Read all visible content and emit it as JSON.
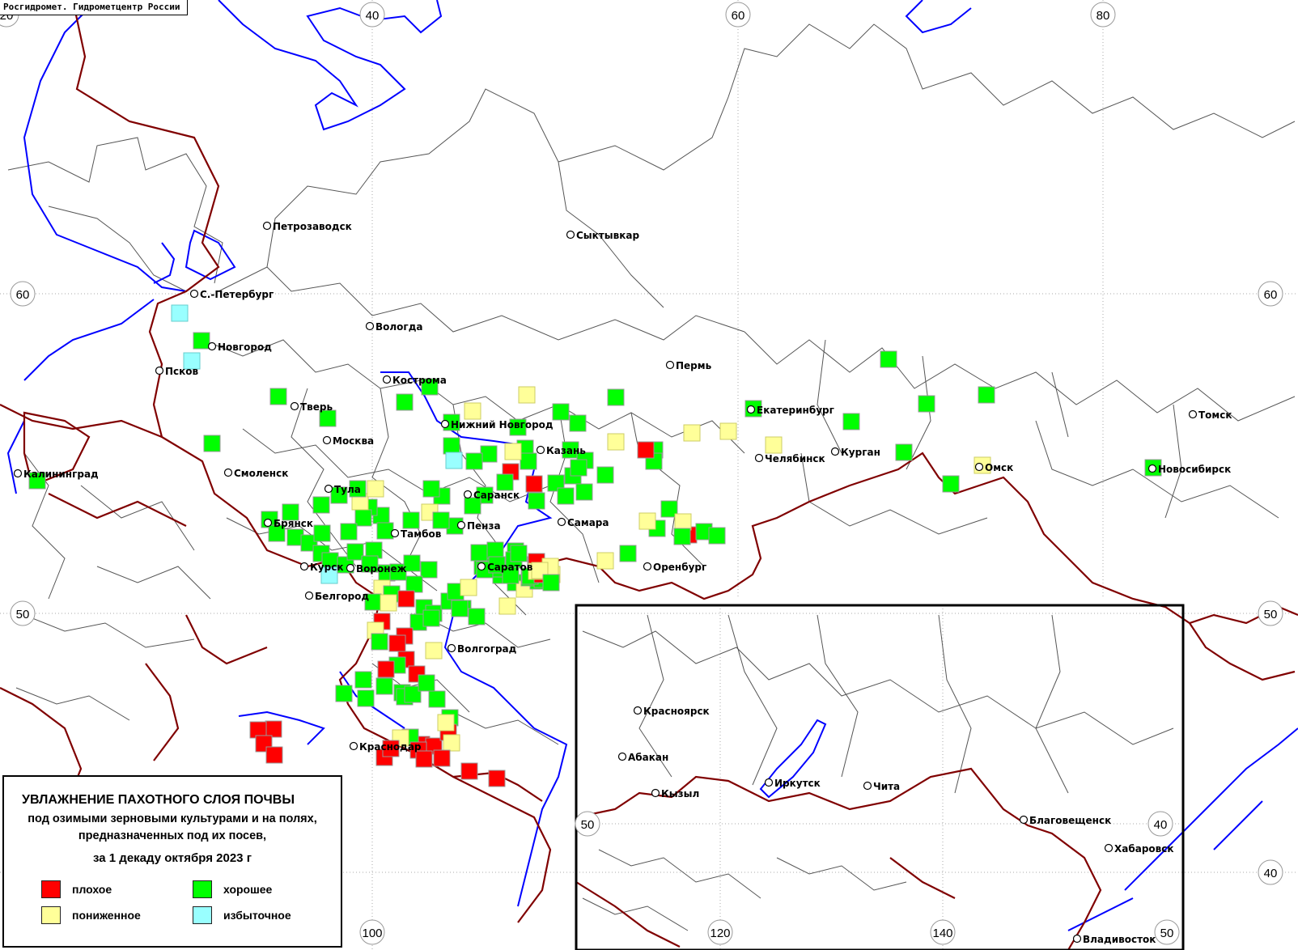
{
  "header": {
    "credit": "Росгидромет. Гидрометцентр России"
  },
  "legend": {
    "title": "УВЛАЖНЕНИЕ ПАХОТНОГО СЛОЯ ПОЧВЫ",
    "subtitle_line1": "под озимыми зерновыми культурами и на полях,",
    "subtitle_line2": "предназначенных под их посев,",
    "period": "за 1 декаду октября 2023 г",
    "items": [
      {
        "key": "poor",
        "label": "плохое",
        "color": "#ff0000"
      },
      {
        "key": "good",
        "label": "хорошее",
        "color": "#00ff00"
      },
      {
        "key": "reduced",
        "label": "пониженное",
        "color": "#ffff99"
      },
      {
        "key": "excess",
        "label": "избыточное",
        "color": "#99ffff"
      }
    ]
  },
  "colors": {
    "poor": "#ff0000",
    "reduced": "#ffff99",
    "good": "#00ff00",
    "excess": "#99ffff",
    "water": "#0000ff",
    "border": "#800000",
    "region": "#555555",
    "grid": "#aaaaaa"
  },
  "grid_labels": [
    "20",
    "40",
    "60",
    "80",
    "60",
    "60",
    "50",
    "50",
    "40",
    "100",
    "120",
    "140",
    "50",
    "50",
    "40"
  ],
  "cities": [
    "Петрозаводск",
    "Сыктывкар",
    "С.-Петербург",
    "Вологда",
    "Новгород",
    "Псков",
    "Кострома",
    "Пермь",
    "Тверь",
    "Екатеринбург",
    "Москва",
    "Нижний Новгород",
    "Казань",
    "Курган",
    "Челябинск",
    "Томск",
    "Калининград",
    "Смоленск",
    "Тула",
    "Саранск",
    "Омск",
    "Новосибирск",
    "Брянск",
    "Самара",
    "Пенза",
    "Тамбов",
    "Оренбург",
    "Курск",
    "Воронеж",
    "Саратов",
    "Белгород",
    "Волгоград",
    "Краснодар",
    "Красноярск",
    "Абакан",
    "Кызыл",
    "Иркутск",
    "Чита",
    "Благовещенск",
    "Хабаровск",
    "Владивосток"
  ],
  "station_categories": [
    "excess",
    "good",
    "excess",
    "good",
    "good",
    "good",
    "good",
    "good",
    "good",
    "good",
    "reduced",
    "reduced",
    "good",
    "good",
    "good",
    "good",
    "good",
    "good",
    "excess",
    "good",
    "poor",
    "good",
    "reduced",
    "poor",
    "good",
    "good",
    "good",
    "good",
    "good",
    "good",
    "good",
    "good",
    "good",
    "good",
    "reduced",
    "good",
    "good",
    "good",
    "good",
    "good",
    "good",
    "good",
    "reduced",
    "good",
    "good",
    "good",
    "good",
    "good",
    "good",
    "good",
    "good",
    "reduced",
    "good",
    "reduced",
    "good",
    "good",
    "good",
    "good",
    "good",
    "good",
    "good",
    "good",
    "good",
    "good",
    "excess",
    "good",
    "good",
    "good",
    "good",
    "good",
    "reduced",
    "good",
    "good",
    "good",
    "good",
    "good",
    "good",
    "good",
    "good",
    "good",
    "good",
    "good",
    "good",
    "reduced",
    "good",
    "good",
    "good",
    "good",
    "reduced",
    "good",
    "good",
    "reduced",
    "reduced",
    "good",
    "good",
    "good",
    "good",
    "good",
    "good",
    "good",
    "good",
    "good",
    "good",
    "good",
    "poor",
    "poor",
    "reduced",
    "reduced",
    "reduced",
    "good",
    "good",
    "poor",
    "poor",
    "poor",
    "poor",
    "reduced",
    "reduced",
    "poor",
    "good",
    "good",
    "good",
    "good",
    "poor",
    "good",
    "poor",
    "reduced",
    "good",
    "good",
    "good",
    "good",
    "good",
    "good",
    "good",
    "good",
    "good",
    "poor",
    "good",
    "poor",
    "poor",
    "reduced",
    "reduced",
    "poor",
    "poor",
    "poor",
    "poor",
    "reduced",
    "poor",
    "poor",
    "poor",
    "poor",
    "poor",
    "poor",
    "poor",
    "reduced",
    "poor",
    "poor",
    "good",
    "reduced",
    "good",
    "good",
    "good",
    "good",
    "reduced",
    "good",
    "reduced",
    "good",
    "good",
    "good",
    "good",
    "good",
    "reduced",
    "good",
    "good",
    "reduced",
    "reduced",
    "good",
    "good",
    "good",
    "good",
    "good",
    "good",
    "good",
    "good",
    "poor",
    "reduced",
    "good",
    "good"
  ]
}
